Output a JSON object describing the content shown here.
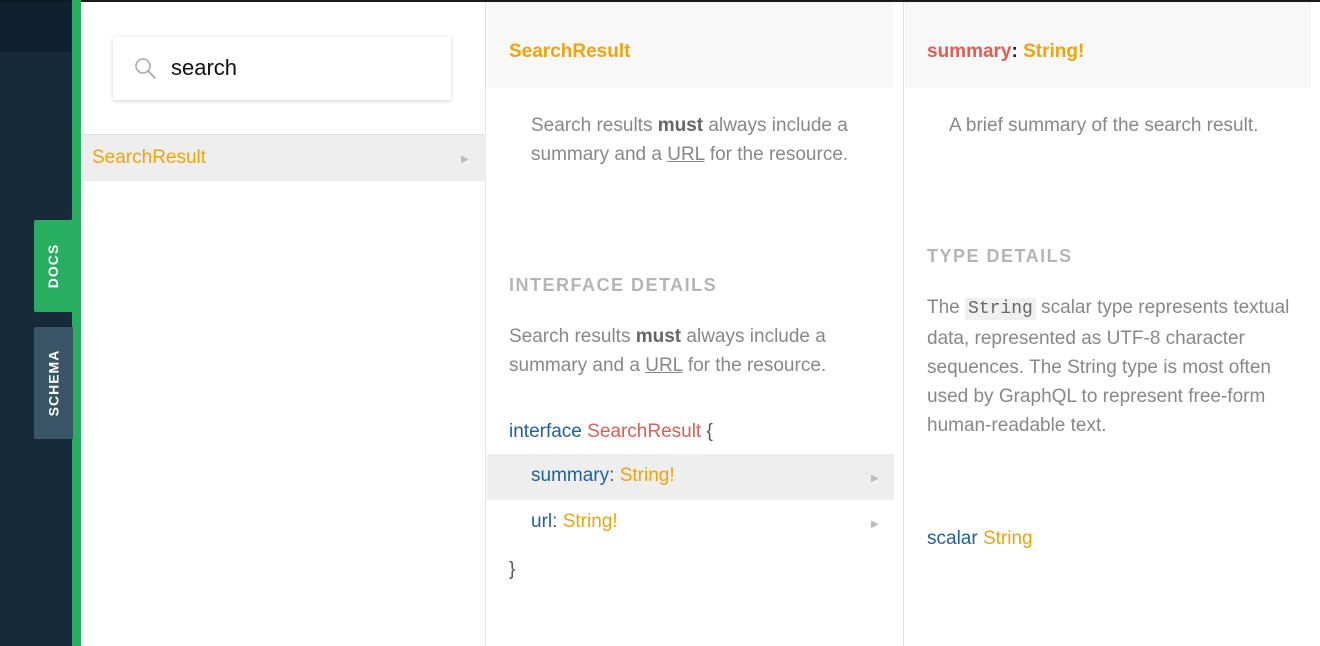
{
  "sidebar": {
    "docs_tab": "DOCS",
    "schema_tab": "SCHEMA"
  },
  "search": {
    "value": "search",
    "icon": "search-icon"
  },
  "results": [
    {
      "name": "SearchResult"
    }
  ],
  "type_panel": {
    "title": "SearchResult",
    "description": {
      "p1": "Search results ",
      "bold": "must",
      "p2": " always include a summary and a ",
      "link": "URL",
      "p3": " for the resource."
    },
    "section_title": "INTERFACE DETAILS",
    "details": {
      "p1": "Search results ",
      "bold": "must",
      "p2": " always include a summary and a ",
      "link": "URL",
      "p3": " for the resource."
    },
    "interface_keyword": "interface",
    "interface_name": "SearchResult",
    "open_brace": "{",
    "close_brace": "}",
    "fields": [
      {
        "name": "summary",
        "colon": ":",
        "type": "String!"
      },
      {
        "name": "url",
        "colon": ":",
        "type": "String!"
      }
    ]
  },
  "field_panel": {
    "title_name": "summary",
    "title_colon": ":",
    "title_type": "String!",
    "description": "A brief summary of the search result.",
    "section_title": "TYPE DETAILS",
    "details": {
      "p1": "The ",
      "code": "String",
      "p2": " scalar type represents textual data, represented as UTF-8 character sequences. The String type is most often used by GraphQL to represent free-form human-readable text."
    },
    "scalar_keyword": "scalar",
    "scalar_name": "String"
  },
  "colors": {
    "accent_green": "#27ae60",
    "type_red": "#e25c52",
    "scalar_orange": "#f2a20a",
    "keyword_blue": "#1f61a0",
    "dark_sidebar": "#172a3a"
  }
}
